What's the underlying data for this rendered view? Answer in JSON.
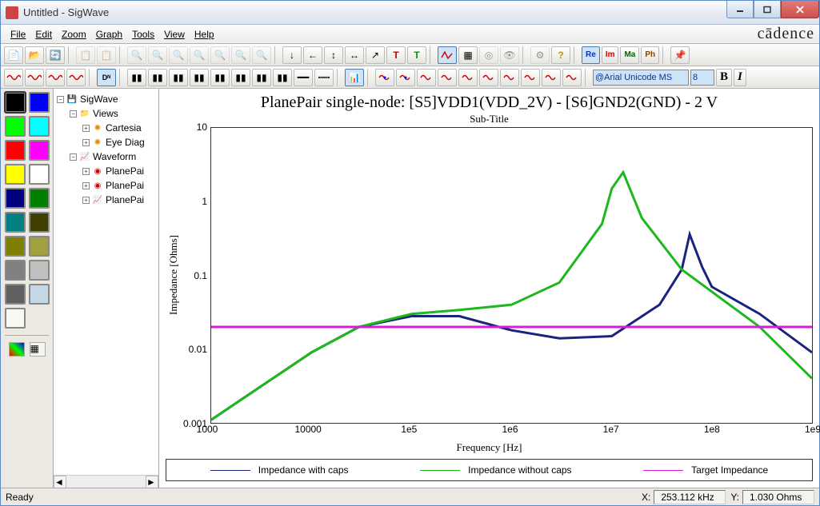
{
  "window": {
    "title": "Untitled - SigWave"
  },
  "menu": {
    "file": "File",
    "edit": "Edit",
    "zoom": "Zoom",
    "graph": "Graph",
    "tools": "Tools",
    "view": "View",
    "help": "Help"
  },
  "brand": "cādence",
  "toolbar1": {
    "re": "Re",
    "im": "Im",
    "ma": "Ma",
    "ph": "Ph"
  },
  "toolbar2": {
    "font": "@Arial Unicode MS",
    "size": "8",
    "bold": "B",
    "italic": "I"
  },
  "palette": {
    "colors": [
      [
        "#000000",
        "#0000ff"
      ],
      [
        "#00ff00",
        "#00ffff"
      ],
      [
        "#ff0000",
        "#ff00ff"
      ],
      [
        "#ffff00",
        "#ffffff"
      ],
      [
        "#000080",
        "#008000"
      ],
      [
        "#008080",
        "#404000"
      ],
      [
        "#808000",
        "#a0a040"
      ],
      [
        "#808080",
        "#c0c0c0"
      ],
      [
        "#606060",
        "#c4d8e8"
      ],
      [
        "#f8f8f0",
        ""
      ]
    ]
  },
  "tree": {
    "root": "SigWave",
    "views": "Views",
    "cartesian": "Cartesia",
    "eyediag": "Eye Diag",
    "wave": "Waveform",
    "pp1": "PlanePai",
    "pp2": "PlanePai",
    "pp3": "PlanePai"
  },
  "status": {
    "ready": "Ready",
    "xlabel": "X:",
    "xval": "253.112 kHz",
    "ylabel": "Y:",
    "yval": "1.030 Ohms"
  },
  "chart_data": {
    "type": "line",
    "title": "PlanePair single-node: [S5]VDD1(VDD_2V) - [S6]GND2(GND) - 2 V",
    "subtitle": "Sub-Title",
    "xlabel": "Frequency [Hz]",
    "ylabel": "Impedance [Ohms]",
    "xscale": "log",
    "yscale": "log",
    "xlim": [
      1000,
      1000000000.0
    ],
    "ylim": [
      0.001,
      10
    ],
    "xticks": [
      "1000",
      "10000",
      "1e5",
      "1e6",
      "1e7",
      "1e8",
      "1e9"
    ],
    "yticks": [
      "0.001",
      "0.01",
      "0.1",
      "1",
      "10"
    ],
    "legend_pos": "bottom",
    "series": [
      {
        "name": "Impedance with caps",
        "color": "#1a237e",
        "x": [
          1000.0,
          3000.0,
          10000.0,
          30000.0,
          100000.0,
          300000.0,
          1000000.0,
          3000000.0,
          10000000.0,
          30000000.0,
          50000000.0,
          60000000.0,
          80000000.0,
          100000000.0,
          300000000.0,
          1000000000.0
        ],
        "y": [
          0.0011,
          0.003,
          0.009,
          0.02,
          0.028,
          0.028,
          0.018,
          0.014,
          0.015,
          0.04,
          0.12,
          0.36,
          0.13,
          0.07,
          0.03,
          0.009
        ]
      },
      {
        "name": "Impedance without caps",
        "color": "#1db81d",
        "x": [
          1000.0,
          3000.0,
          10000.0,
          30000.0,
          100000.0,
          300000.0,
          1000000.0,
          3000000.0,
          8000000.0,
          10000000.0,
          13000000.0,
          20000000.0,
          50000000.0,
          100000000.0,
          300000000.0,
          1000000000.0
        ],
        "y": [
          0.0011,
          0.003,
          0.009,
          0.02,
          0.03,
          0.034,
          0.04,
          0.08,
          0.5,
          1.5,
          2.5,
          0.6,
          0.12,
          0.06,
          0.02,
          0.004
        ]
      },
      {
        "name": "Target Impedance",
        "color": "#d81bd8",
        "x": [
          1000.0,
          1000000000.0
        ],
        "y": [
          0.02,
          0.02
        ]
      }
    ]
  }
}
